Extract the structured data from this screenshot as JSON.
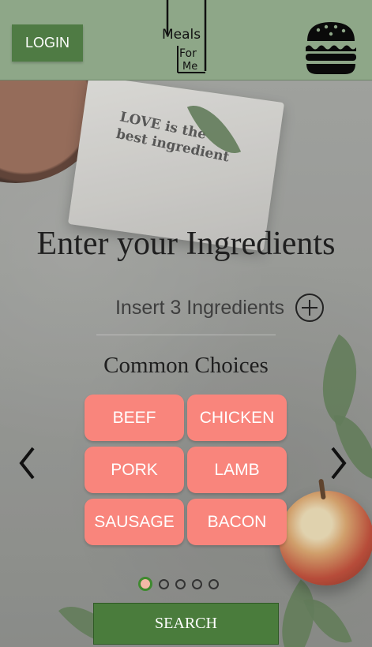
{
  "header": {
    "login_label": "LOGIN",
    "logo_text": [
      "Meals",
      "For",
      "Me"
    ]
  },
  "decor": {
    "paper_text": "LOVE is the\nbest ingredient"
  },
  "main": {
    "title": "Enter your Ingredients",
    "ingredient_placeholder": "Insert 3 Ingredients",
    "common_title": "Common Choices",
    "choices": [
      "BEEF",
      "CHICKEN",
      "PORK",
      "LAMB",
      "SAUSAGE",
      "BACON"
    ]
  },
  "carousel": {
    "page_count": 5,
    "active_page": 1
  },
  "search_label": "SEARCH",
  "colors": {
    "header": "#8ea788",
    "button": "#4f7b44",
    "chip": "#f9857c",
    "search": "#4a7c3c"
  },
  "icons": {
    "menu": "hamburger-menu-icon",
    "add": "plus-circle-icon",
    "prev": "chevron-left-icon",
    "next": "chevron-right-icon"
  }
}
